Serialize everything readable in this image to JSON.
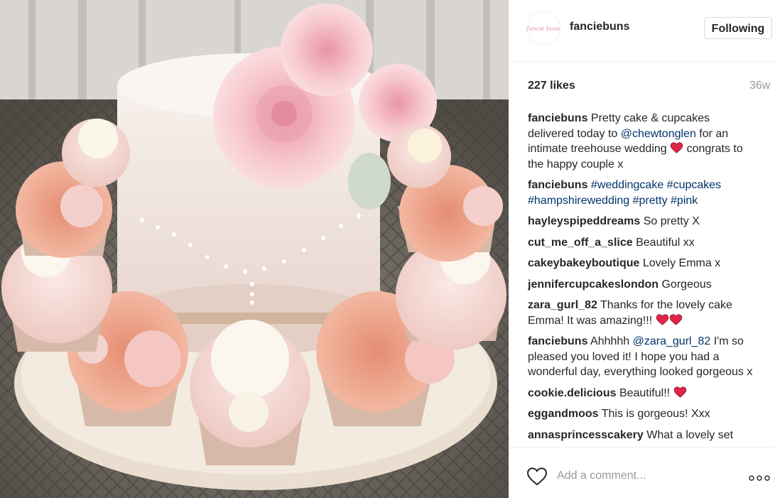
{
  "post": {
    "username": "fanciebuns",
    "avatar_text": "fancie buns",
    "follow_button_label": "Following",
    "likes": "227 likes",
    "age": "36w"
  },
  "comments": [
    {
      "user": "fanciebuns",
      "parts": [
        "Pretty cake & cupcakes delivered today to ",
        "@chewtonglen",
        " for an intimate treehouse wedding",
        " congrats to the happy couple x"
      ]
    },
    {
      "user": "fanciebuns",
      "tags": [
        "#weddingcake",
        "#cupcakes",
        "#hampshirewedding",
        "#pretty",
        "#pink"
      ]
    },
    {
      "user": "hayleyspipeddreams",
      "text": "So pretty X"
    },
    {
      "user": "cut_me_off_a_slice",
      "text": "Beautiful xx"
    },
    {
      "user": "cakeybakeyboutique",
      "text": "Lovely Emma x"
    },
    {
      "user": "jennifercupcakeslondon",
      "text": "Gorgeous"
    },
    {
      "user": "zara_gurl_82",
      "text": "Thanks for the lovely cake Emma! It was amazing!!!"
    },
    {
      "user": "fanciebuns",
      "parts": [
        "Ahhhhh ",
        "@zara_gurl_82",
        " I'm so pleased you loved it! I hope you had a wonderful day, everything looked gorgeous x"
      ]
    },
    {
      "user": "cookie.delicious",
      "text": "Beautiful!!"
    },
    {
      "user": "eggandmoos",
      "text": "This is gorgeous! Xxx"
    },
    {
      "user": "annasprincesscakery",
      "text": "What a lovely set"
    }
  ],
  "composer": {
    "placeholder": "Add a comment...",
    "like_icon": "heart-outline-icon",
    "more_icon": "more-options-icon"
  },
  "colors": {
    "link": "#003569",
    "heart_red": "#ed4956",
    "muted": "#999999"
  }
}
